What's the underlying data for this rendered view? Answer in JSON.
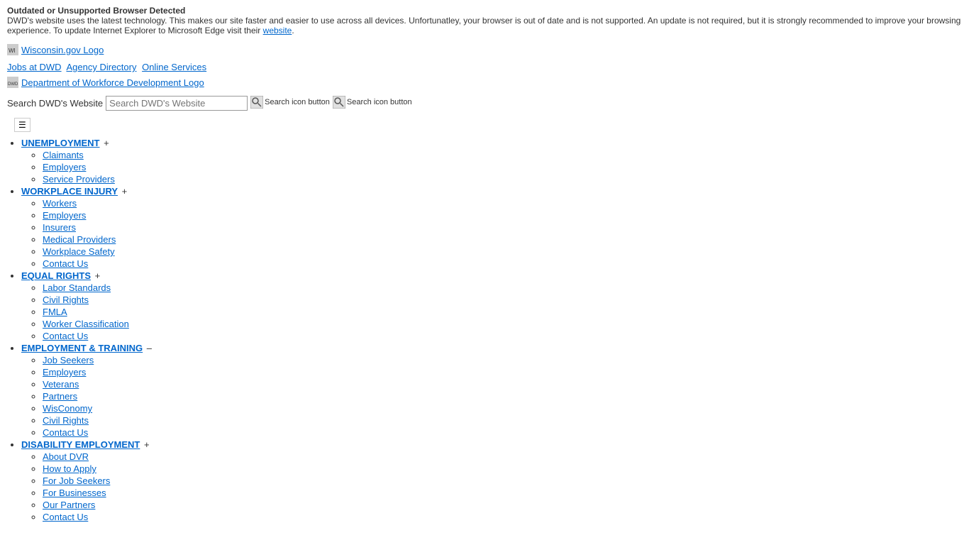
{
  "browser_warning": {
    "title": "Outdated or Unsupported Browser Detected",
    "message": "DWD's website uses the latest technology. This makes our site faster and easier to use across all devices. Unfortunatley, your browser is out of date and is not supported. An update is not required, but it is strongly recommended to improve your browsing experience. To update Internet Explorer to Microsoft Edge visit their",
    "link_text": "website",
    "link_url": "#"
  },
  "wi_logo": {
    "alt": "Wisconsin.gov Logo",
    "text": "Wisconsin.gov Logo"
  },
  "utility_links": [
    {
      "label": "Jobs at DWD",
      "url": "#"
    },
    {
      "label": "Agency Directory",
      "url": "#"
    },
    {
      "label": "Online Services",
      "url": "#"
    }
  ],
  "dwd_logo": {
    "alt": "Department of Workforce Development Logo",
    "text": "Department of Workforce Development Logo"
  },
  "search": {
    "label": "Search DWD's Website",
    "placeholder": "Search DWD's Website"
  },
  "nav": {
    "sections": [
      {
        "id": "unemployment",
        "label": "UNEMPLOYMENT",
        "toggle": "+",
        "items": [
          {
            "label": "Claimants",
            "url": "#"
          },
          {
            "label": "Employers",
            "url": "#"
          },
          {
            "label": "Service Providers",
            "url": "#"
          }
        ]
      },
      {
        "id": "workplace-injury",
        "label": "WORKPLACE INJURY",
        "toggle": "+",
        "items": [
          {
            "label": "Workers",
            "url": "#"
          },
          {
            "label": "Employers",
            "url": "#"
          },
          {
            "label": "Insurers",
            "url": "#"
          },
          {
            "label": "Medical Providers",
            "url": "#"
          },
          {
            "label": "Workplace Safety",
            "url": "#"
          },
          {
            "label": "Contact Us",
            "url": "#"
          }
        ]
      },
      {
        "id": "equal-rights",
        "label": "EQUAL RIGHTS",
        "toggle": "+",
        "items": [
          {
            "label": "Labor Standards",
            "url": "#"
          },
          {
            "label": "Civil Rights",
            "url": "#"
          },
          {
            "label": "FMLA",
            "url": "#"
          },
          {
            "label": "Worker Classification",
            "url": "#"
          },
          {
            "label": "Contact Us",
            "url": "#"
          }
        ]
      },
      {
        "id": "employment-training",
        "label": "EMPLOYMENT & TRAINING",
        "toggle": "–",
        "items": [
          {
            "label": "Job Seekers",
            "url": "#"
          },
          {
            "label": "Employers",
            "url": "#"
          },
          {
            "label": "Veterans",
            "url": "#"
          },
          {
            "label": "Partners",
            "url": "#"
          },
          {
            "label": "WisConomy",
            "url": "#"
          },
          {
            "label": "Civil Rights",
            "url": "#"
          },
          {
            "label": "Contact Us",
            "url": "#"
          }
        ]
      },
      {
        "id": "disability-employment",
        "label": "DISABILITY EMPLOYMENT",
        "toggle": "+",
        "items": [
          {
            "label": "About DVR",
            "url": "#"
          },
          {
            "label": "How to Apply",
            "url": "#"
          },
          {
            "label": "For Job Seekers",
            "url": "#"
          },
          {
            "label": "For Businesses",
            "url": "#"
          },
          {
            "label": "Our Partners",
            "url": "#"
          },
          {
            "label": "Contact Us",
            "url": "#"
          }
        ]
      }
    ]
  }
}
